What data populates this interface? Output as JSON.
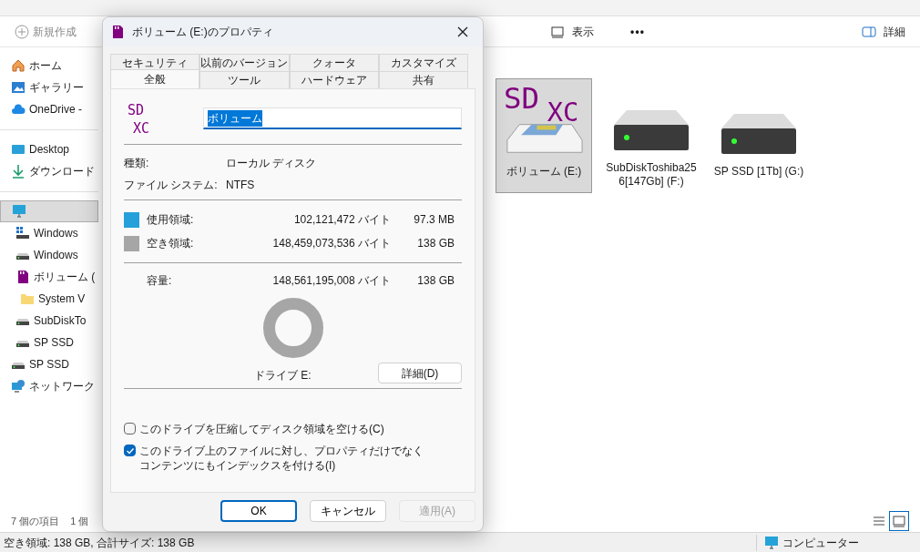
{
  "explorer": {
    "toolbar": {
      "new_button": "新規作成",
      "view_button": "表示",
      "more_button": "•••",
      "details_button": "詳細"
    },
    "sidebar": {
      "items": [
        {
          "label": "ホーム",
          "kind": "home",
          "selected": false
        },
        {
          "label": "ギャラリー",
          "kind": "gallery",
          "selected": false
        },
        {
          "label": "OneDrive -",
          "kind": "cloud",
          "selected": false
        },
        {
          "label": "Desktop",
          "kind": "desktop",
          "selected": false
        },
        {
          "label": "ダウンロード",
          "kind": "download",
          "selected": false
        },
        {
          "kind": "pc",
          "selected": true,
          "children": [
            {
              "label": "Windows",
              "kind": "windows-drive",
              "selected": false
            },
            {
              "label": "Windows",
              "kind": "drive",
              "selected": false
            },
            {
              "label": "ボリューム (",
              "kind": "sd",
              "selected": false,
              "children": [
                {
                  "label": "System V",
                  "kind": "folder",
                  "selected": false
                }
              ]
            },
            {
              "label": "SubDiskTo",
              "kind": "drive",
              "selected": false
            },
            {
              "label": "SP SSD",
              "kind": "drive",
              "selected": false
            }
          ]
        },
        {
          "label": "SP SSD",
          "kind": "drive",
          "selected": false
        },
        {
          "label": "ネットワーク",
          "kind": "network",
          "selected": false
        }
      ]
    },
    "drives": [
      {
        "label": "ボリューム (E:)",
        "kind": "sd",
        "selected": true,
        "icon_text": [
          "SD",
          "XC"
        ]
      },
      {
        "label": "SubDiskToshiba256[147Gb] (F:)",
        "kind": "drive",
        "selected": false
      },
      {
        "label": "SP SSD [1Tb] (G:)",
        "kind": "drive",
        "selected": false
      }
    ],
    "status_bar": {
      "item_count": "7 個の項目",
      "selection": "1 個",
      "views": [
        {
          "kind": "list",
          "selected": false
        },
        {
          "kind": "tiles",
          "selected": true
        }
      ]
    },
    "bottom_bar": {
      "summary": "空き領域: 138 GB, 合計サイズ: 138 GB",
      "location": "コンピューター"
    }
  },
  "dialog": {
    "title": "ボリューム (E:)のプロパティ",
    "tab_rows": [
      [
        {
          "label": "セキュリティ",
          "selected": false
        },
        {
          "label": "以前のバージョン",
          "selected": false
        },
        {
          "label": "クォータ",
          "selected": false
        },
        {
          "label": "カスタマイズ",
          "selected": false
        }
      ],
      [
        {
          "label": "全般",
          "selected": true
        },
        {
          "label": "ツール",
          "selected": false
        },
        {
          "label": "ハードウェア",
          "selected": false
        },
        {
          "label": "共有",
          "selected": false
        }
      ]
    ],
    "icon_text": [
      "SD",
      "XC"
    ],
    "name_field": {
      "value": "ボリューム",
      "selected": true
    },
    "info": [
      {
        "label": "種類:",
        "value": "ローカル ディスク"
      },
      {
        "label": "ファイル システム:",
        "value": "NTFS"
      }
    ],
    "usage": [
      {
        "label": "使用領域:",
        "bytes": "102,121,472 バイト",
        "size": "97.3 MB",
        "color": "#26a0da"
      },
      {
        "label": "空き領域:",
        "bytes": "148,459,073,536 バイト",
        "size": "138 GB",
        "color": "#a6a6a6"
      }
    ],
    "capacity": {
      "label": "容量:",
      "bytes": "148,561,195,008 バイト",
      "size": "138 GB"
    },
    "drive_label": "ドライブ E:",
    "details_button": "詳細(D)",
    "checkboxes": [
      {
        "label": "このドライブを圧縮してディスク領域を空ける(C)",
        "checked": false
      },
      {
        "label": "このドライブ上のファイルに対し、プロパティだけでなくコンテンツにもインデックスを付ける(I)",
        "checked": true
      }
    ],
    "buttons": [
      {
        "label": "OK",
        "default": true,
        "disabled": false
      },
      {
        "label": "キャンセル",
        "default": false,
        "disabled": false
      },
      {
        "label": "適用(A)",
        "default": false,
        "disabled": true
      }
    ]
  }
}
